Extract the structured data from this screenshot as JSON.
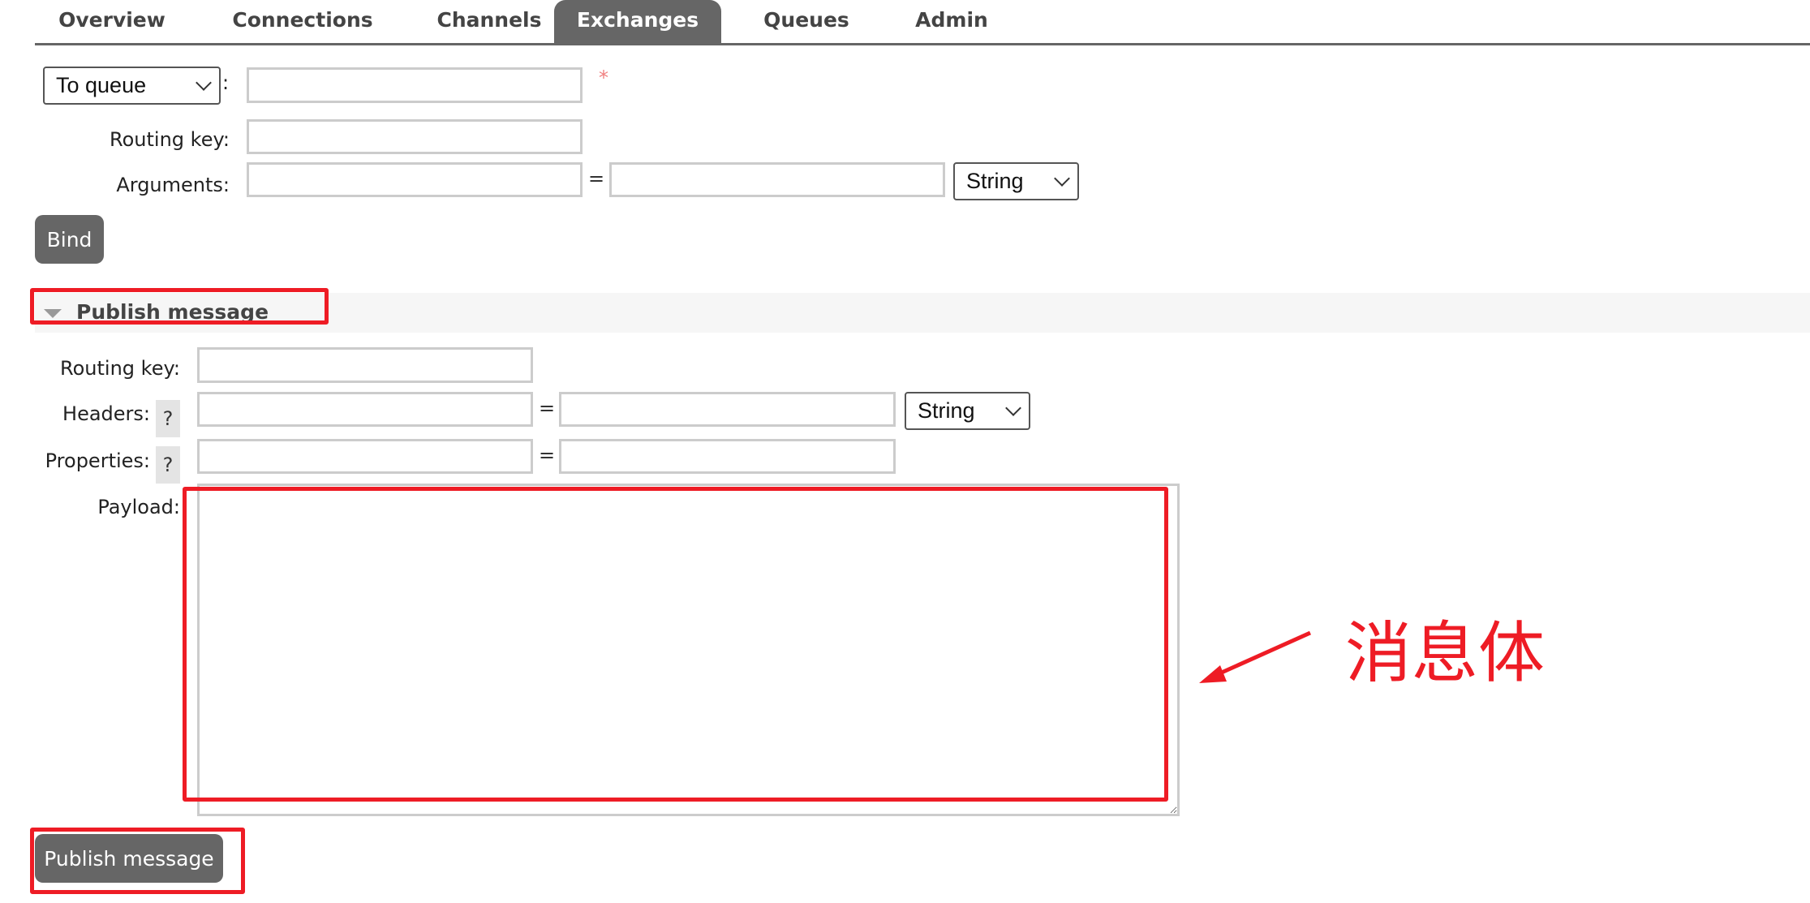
{
  "tabs": [
    {
      "label": "Overview",
      "active": false
    },
    {
      "label": "Connections",
      "active": false
    },
    {
      "label": "Channels",
      "active": false
    },
    {
      "label": "Exchanges",
      "active": true
    },
    {
      "label": "Queues",
      "active": false
    },
    {
      "label": "Admin",
      "active": false
    }
  ],
  "bind_form": {
    "destination_type": "To queue",
    "destination_colon": ":",
    "destination_value": "",
    "required_marker": "*",
    "routing_key_label": "Routing key:",
    "routing_key_value": "",
    "arguments_label": "Arguments:",
    "argument_key": "",
    "argument_eq": "=",
    "argument_value": "",
    "argument_type": "String",
    "bind_button": "Bind"
  },
  "publish_section": {
    "title": "Publish message",
    "routing_key_label": "Routing key:",
    "routing_key_value": "",
    "headers_label": "Headers:",
    "headers_help": "?",
    "header_key": "",
    "header_eq": "=",
    "header_value": "",
    "header_type": "String",
    "properties_label": "Properties:",
    "properties_help": "?",
    "property_key": "",
    "property_eq": "=",
    "property_value": "",
    "payload_label": "Payload:",
    "payload_value": "",
    "publish_button": "Publish message"
  },
  "annotation": {
    "text": "消息体",
    "color": "#ee1c25"
  },
  "colors": {
    "accent_gray": "#666666",
    "highlight_red": "#ee1c25",
    "required_red": "#f08080"
  }
}
